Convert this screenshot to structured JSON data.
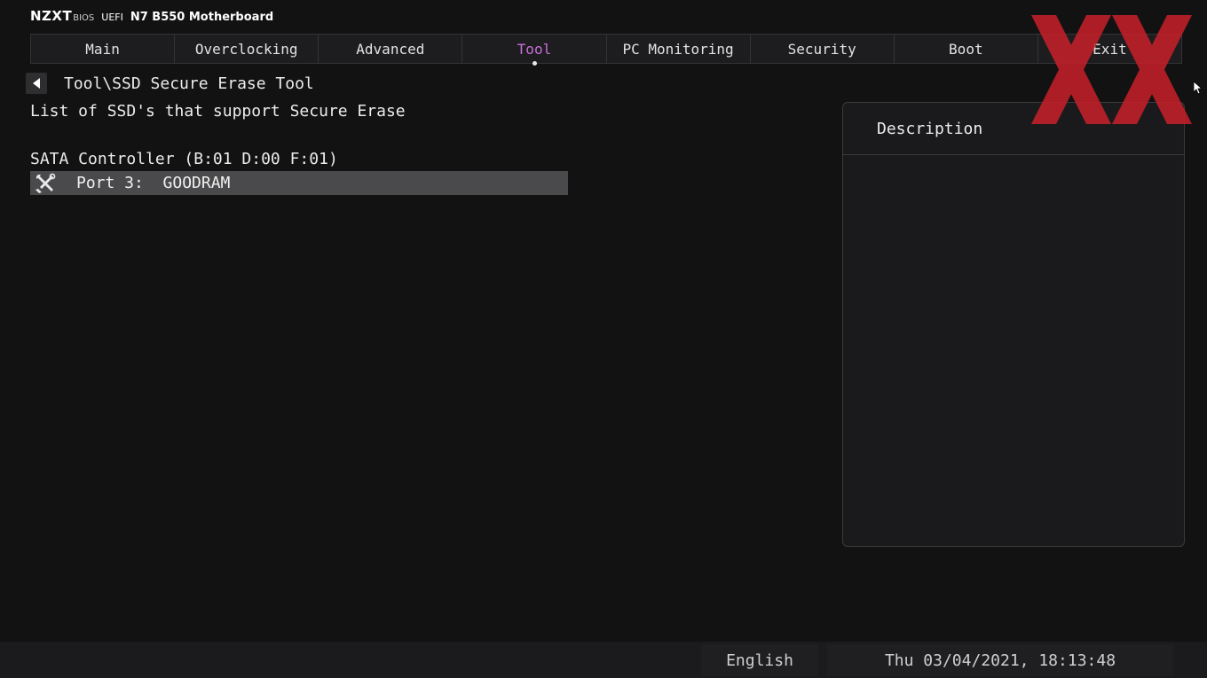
{
  "brand": {
    "logo": "NZXT",
    "bios": "BIOS",
    "uefi": "UEFI",
    "model": "N7 B550 Motherboard"
  },
  "tabs": [
    {
      "label": "Main",
      "active": false
    },
    {
      "label": "Overclocking",
      "active": false
    },
    {
      "label": "Advanced",
      "active": false
    },
    {
      "label": "Tool",
      "active": true
    },
    {
      "label": "PC Monitoring",
      "active": false
    },
    {
      "label": "Security",
      "active": false
    },
    {
      "label": "Boot",
      "active": false
    },
    {
      "label": "Exit",
      "active": false
    }
  ],
  "page": {
    "back_icon": "back-arrow-icon",
    "breadcrumb": "Tool\\SSD Secure Erase Tool",
    "subtitle": "List of SSD's that support Secure Erase",
    "controller": "SATA Controller (B:01 D:00 F:01)",
    "ports": [
      {
        "icon": "wrench-screwdriver-icon",
        "label": "Port 3:  GOODRAM"
      }
    ]
  },
  "description": {
    "title": "Description"
  },
  "footer": {
    "language": "English",
    "datetime": "Thu 03/04/2021, 18:13:48"
  },
  "colors": {
    "background": "#121213",
    "active_tab": "#c76ed6",
    "selected_row": "#4a4a4c",
    "watermark": "#c8202a"
  }
}
